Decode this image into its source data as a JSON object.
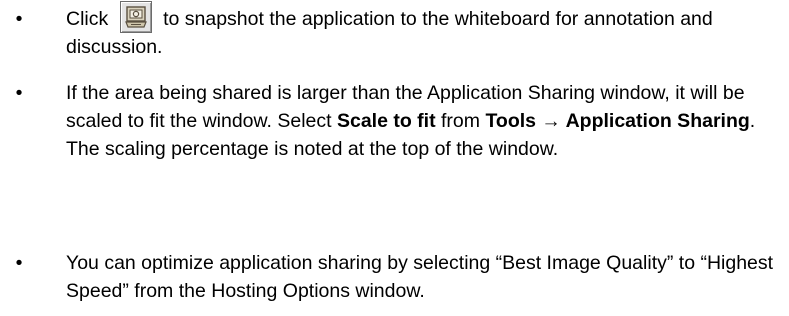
{
  "bullets": [
    {
      "segments": [
        {
          "t": "Click ",
          "b": false
        },
        {
          "icon": "snapshot-camera-icon"
        },
        {
          "t": " to snapshot the application to the whiteboard for annotation and discussion.",
          "b": false
        }
      ]
    },
    {
      "segments": [
        {
          "t": "If the area being shared is larger than the Application Sharing window, it will be scaled to fit the window. Select ",
          "b": false
        },
        {
          "t": "Scale to fit",
          "b": true
        },
        {
          "t": " from ",
          "b": false
        },
        {
          "t": "Tools → Application Sharing",
          "b": true
        },
        {
          "t": ". The scaling percentage is noted at the top of the window.",
          "b": false
        }
      ]
    },
    {
      "segments": [
        {
          "t": "You can optimize application sharing by selecting “Best Image Quality” to “Highest Speed” from the Hosting Options window.",
          "b": false
        }
      ]
    }
  ],
  "bullet_glyph": "•",
  "accent_colors": {
    "icon_fill": "#d9d2bd",
    "icon_stroke": "#5a5040",
    "button_face": "#e4e4e4"
  }
}
